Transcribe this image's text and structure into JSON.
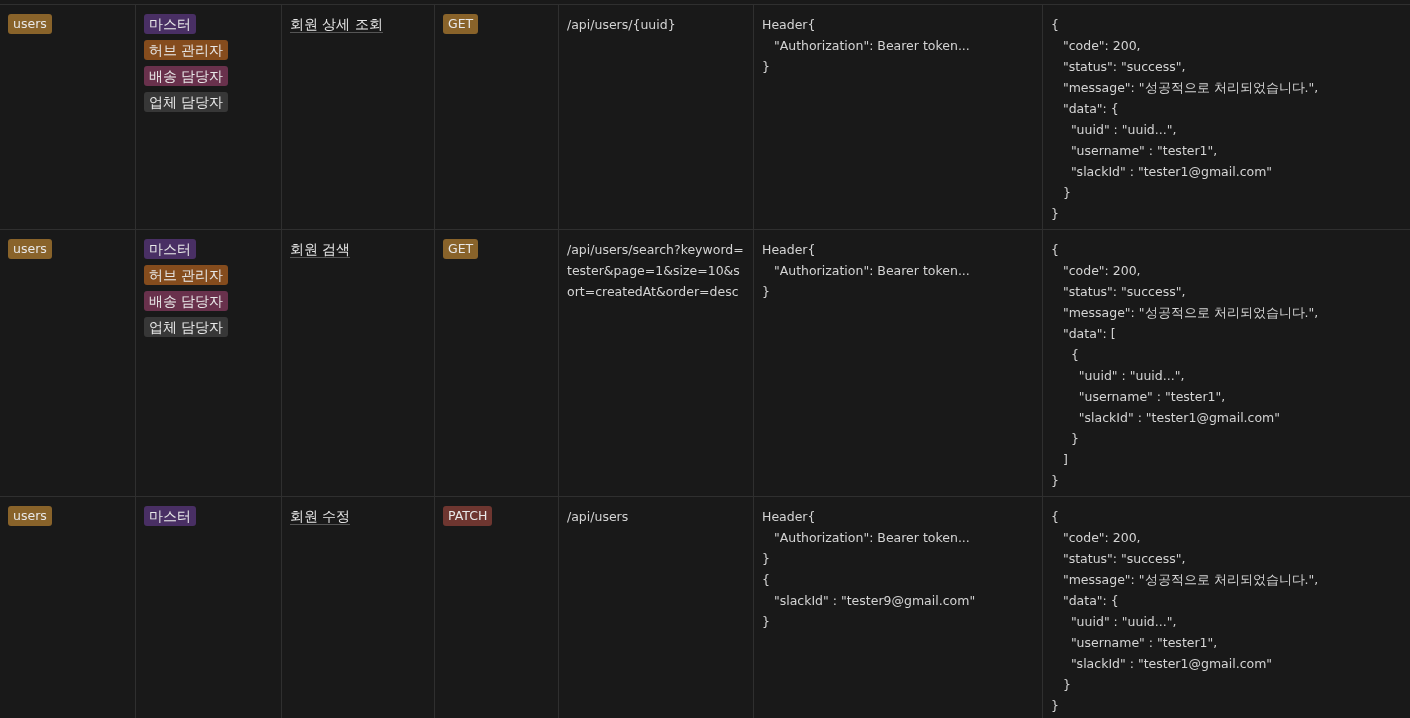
{
  "rows": [
    {
      "category": {
        "label": "users",
        "color": "#89632a"
      },
      "roles": [
        {
          "label": "마스터",
          "color": "#492f64"
        },
        {
          "label": "허브 관리자",
          "color": "#854c1d"
        },
        {
          "label": "배송 담당자",
          "color": "#69314c"
        },
        {
          "label": "업체 담당자",
          "color": "#373737"
        }
      ],
      "name": "회원 상세 조회",
      "method": {
        "label": "GET",
        "color": "#89632a"
      },
      "url": "/api/users/{uuid}",
      "request": "Header{\n   \"Authorization\": Bearer token...\n}",
      "response": "{\n   \"code\": 200,\n   \"status\": \"success\",\n   \"message\": \"성공적으로 처리되었습니다.\",\n   \"data\": {\n     \"uuid\" : \"uuid...\",\n     \"username\" : \"tester1\",\n     \"slackId\" : \"tester1@gmail.com\"\n   }\n}"
    },
    {
      "category": {
        "label": "users",
        "color": "#89632a"
      },
      "roles": [
        {
          "label": "마스터",
          "color": "#492f64"
        },
        {
          "label": "허브 관리자",
          "color": "#854c1d"
        },
        {
          "label": "배송 담당자",
          "color": "#69314c"
        },
        {
          "label": "업체 담당자",
          "color": "#373737"
        }
      ],
      "name": "회원 검색",
      "method": {
        "label": "GET",
        "color": "#89632a"
      },
      "url": "/api/users/search?keyword=tester&page=1&size=10&sort=createdAt&order=desc",
      "request": "Header{\n   \"Authorization\": Bearer token...\n}",
      "response": "{\n   \"code\": 200,\n   \"status\": \"success\",\n   \"message\": \"성공적으로 처리되었습니다.\",\n   \"data\": [\n     {\n       \"uuid\" : \"uuid...\",\n       \"username\" : \"tester1\",\n       \"slackId\" : \"tester1@gmail.com\"\n     }\n   ]\n}"
    },
    {
      "category": {
        "label": "users",
        "color": "#89632a"
      },
      "roles": [
        {
          "label": "마스터",
          "color": "#492f64"
        }
      ],
      "name": "회원 수정",
      "method": {
        "label": "PATCH",
        "color": "#6e3630"
      },
      "url": "/api/users",
      "request": "Header{\n   \"Authorization\": Bearer token...\n}\n{\n   \"slackId\" : \"tester9@gmail.com\"\n}",
      "response": "{\n   \"code\": 200,\n   \"status\": \"success\",\n   \"message\": \"성공적으로 처리되었습니다.\",\n   \"data\": {\n     \"uuid\" : \"uuid...\",\n     \"username\" : \"tester1\",\n     \"slackId\" : \"tester1@gmail.com\"\n   }\n}"
    }
  ]
}
